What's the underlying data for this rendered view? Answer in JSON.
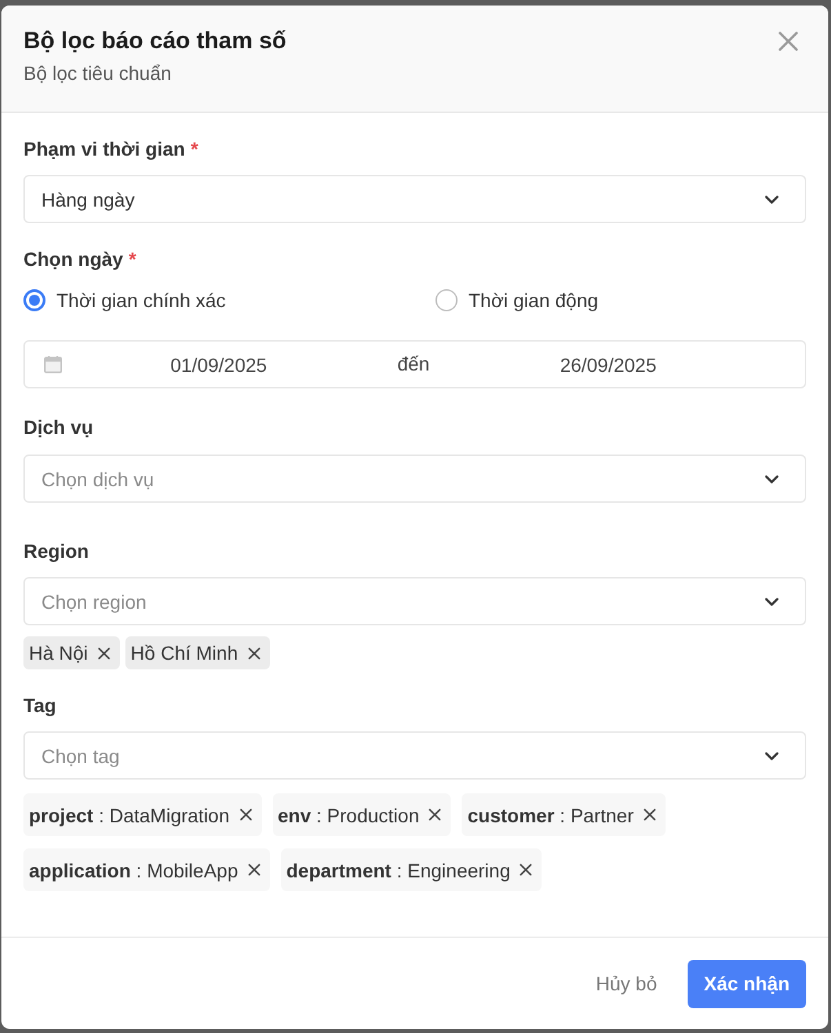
{
  "dialog": {
    "title": "Bộ lọc báo cáo tham số",
    "subtitle": "Bộ lọc tiêu chuẩn"
  },
  "time_range": {
    "label": "Phạm vi thời gian",
    "required_mark": "*",
    "value": "Hàng ngày"
  },
  "date": {
    "label": "Chọn ngày",
    "required_mark": "*",
    "options": [
      {
        "label": "Thời gian chính xác",
        "selected": true
      },
      {
        "label": "Thời gian động",
        "selected": false
      }
    ],
    "range": {
      "start": "01/09/2025",
      "separator": "đến",
      "end": "26/09/2025"
    }
  },
  "service": {
    "label": "Dịch vụ",
    "placeholder": "Chọn dịch vụ"
  },
  "region": {
    "label": "Region",
    "placeholder": "Chọn region",
    "chips": [
      "Hà Nội",
      "Hồ Chí Minh"
    ]
  },
  "tag": {
    "label": "Tag",
    "placeholder": "Chọn tag",
    "chips": [
      "**project** : DataMigration",
      "**env** : Production",
      "**customer** : Partner",
      "**application** : MobileApp",
      "**department** : Engineering"
    ]
  },
  "buttons": [
    {
      "label": "Hủy bỏ",
      "kind": "text"
    },
    {
      "label": "Xác nhận",
      "kind": "primary"
    }
  ]
}
